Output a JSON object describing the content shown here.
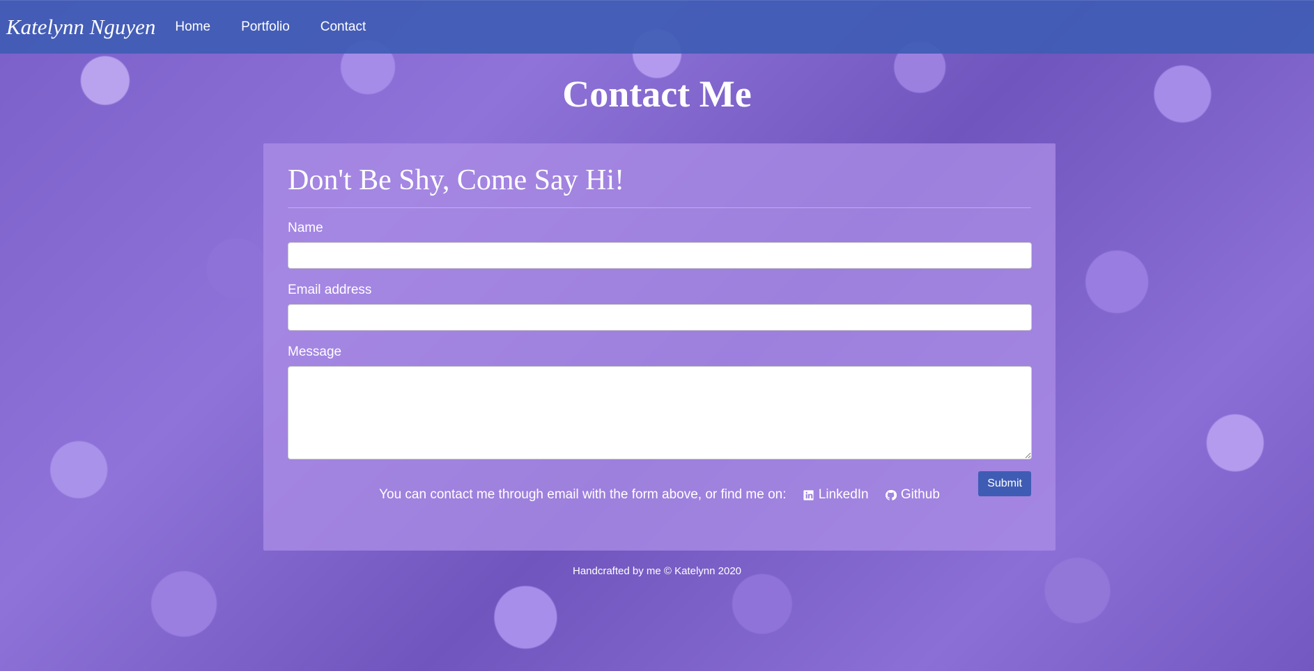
{
  "navbar": {
    "brand": "Katelynn Nguyen",
    "links": [
      {
        "label": "Home"
      },
      {
        "label": "Portfolio"
      },
      {
        "label": "Contact"
      }
    ]
  },
  "page": {
    "title": "Contact Me"
  },
  "form": {
    "heading": "Don't Be Shy, Come Say Hi!",
    "name_label": "Name",
    "name_value": "",
    "email_label": "Email address",
    "email_value": "",
    "message_label": "Message",
    "message_value": "",
    "submit_label": "Submit"
  },
  "contact": {
    "text": "You can contact me through email with the form above, or find me on:",
    "linkedin_label": "LinkedIn",
    "linkedin_icon": "linkedin-icon",
    "github_label": "Github",
    "github_icon": "github-icon"
  },
  "footer": {
    "text": "Handcrafted by me © Katelynn 2020"
  },
  "colors": {
    "navbar": "#3f5cb4",
    "card": "#aa8ce6",
    "button": "#3f5cb4"
  }
}
